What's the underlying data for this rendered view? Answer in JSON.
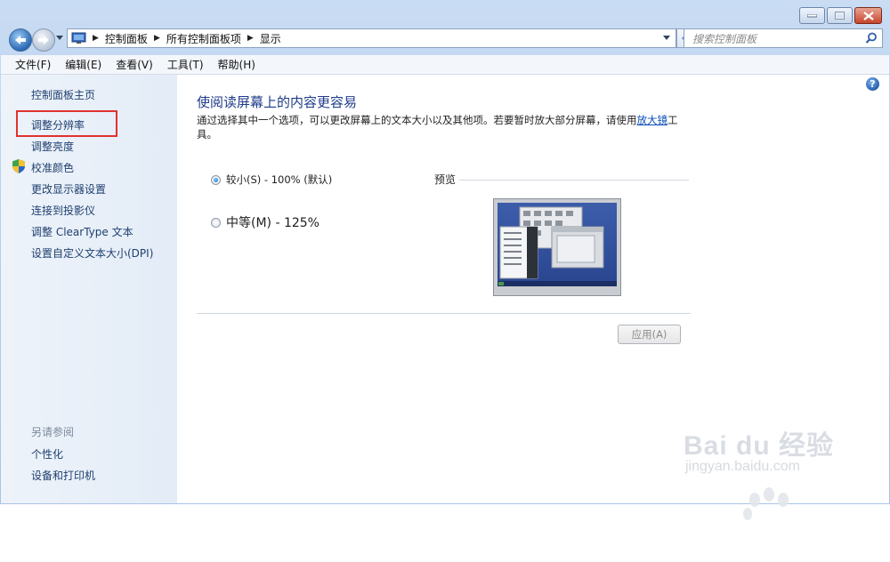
{
  "window": {
    "caption_buttons": [
      "minimize",
      "maximize",
      "close"
    ]
  },
  "navigation": {
    "breadcrumbs": [
      "控制面板",
      "所有控制面板项",
      "显示"
    ],
    "search_placeholder": "搜索控制面板"
  },
  "menu": [
    "文件(F)",
    "编辑(E)",
    "查看(V)",
    "工具(T)",
    "帮助(H)"
  ],
  "sidebar": {
    "home": "控制面板主页",
    "links": [
      "调整分辨率",
      "调整亮度",
      "校准颜色",
      "更改显示器设置",
      "连接到投影仪",
      "调整 ClearType 文本",
      "设置自定义文本大小(DPI)"
    ],
    "highlighted_link": "调整分辨率",
    "highlight_color": "#e0322e",
    "see_also_title": "另请参阅",
    "see_also": [
      "个性化",
      "设备和打印机"
    ]
  },
  "main": {
    "heading": "使阅读屏幕上的内容更容易",
    "description_prefix": "通过选择其中一个选项，可以更改屏幕上的文本大小以及其他项。若要暂时放大部分屏幕，请使用",
    "description_link": "放大镜",
    "description_suffix": "工具。",
    "options": [
      {
        "label": "较小(S) - 100% (默认)",
        "selected": true
      },
      {
        "label": "中等(M) - 125%",
        "selected": false
      }
    ],
    "preview_label": "预览",
    "apply_button": "应用(A)",
    "help": "?"
  },
  "watermark": {
    "brand": "Bai du 经验",
    "url": "jingyan.baidu.com"
  }
}
